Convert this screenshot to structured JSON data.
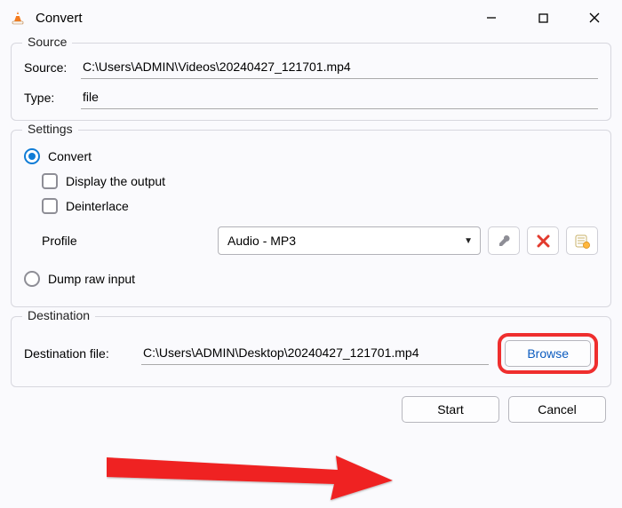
{
  "window": {
    "title": "Convert"
  },
  "source_group": {
    "legend": "Source",
    "source_label": "Source:",
    "source_value": "C:\\Users\\ADMIN\\Videos\\20240427_121701.mp4",
    "type_label": "Type:",
    "type_value": "file"
  },
  "settings_group": {
    "legend": "Settings",
    "convert_label": "Convert",
    "display_output_label": "Display the output",
    "deinterlace_label": "Deinterlace",
    "profile_label": "Profile",
    "profile_value": "Audio - MP3",
    "dump_label": "Dump raw input"
  },
  "destination_group": {
    "legend": "Destination",
    "dest_label": "Destination file:",
    "dest_value": "C:\\Users\\ADMIN\\Desktop\\20240427_121701.mp4",
    "browse_label": "Browse"
  },
  "footer": {
    "start_label": "Start",
    "cancel_label": "Cancel"
  },
  "icons": {
    "wrench": "wrench-icon",
    "delete": "delete-icon",
    "new_profile": "new-profile-icon"
  }
}
